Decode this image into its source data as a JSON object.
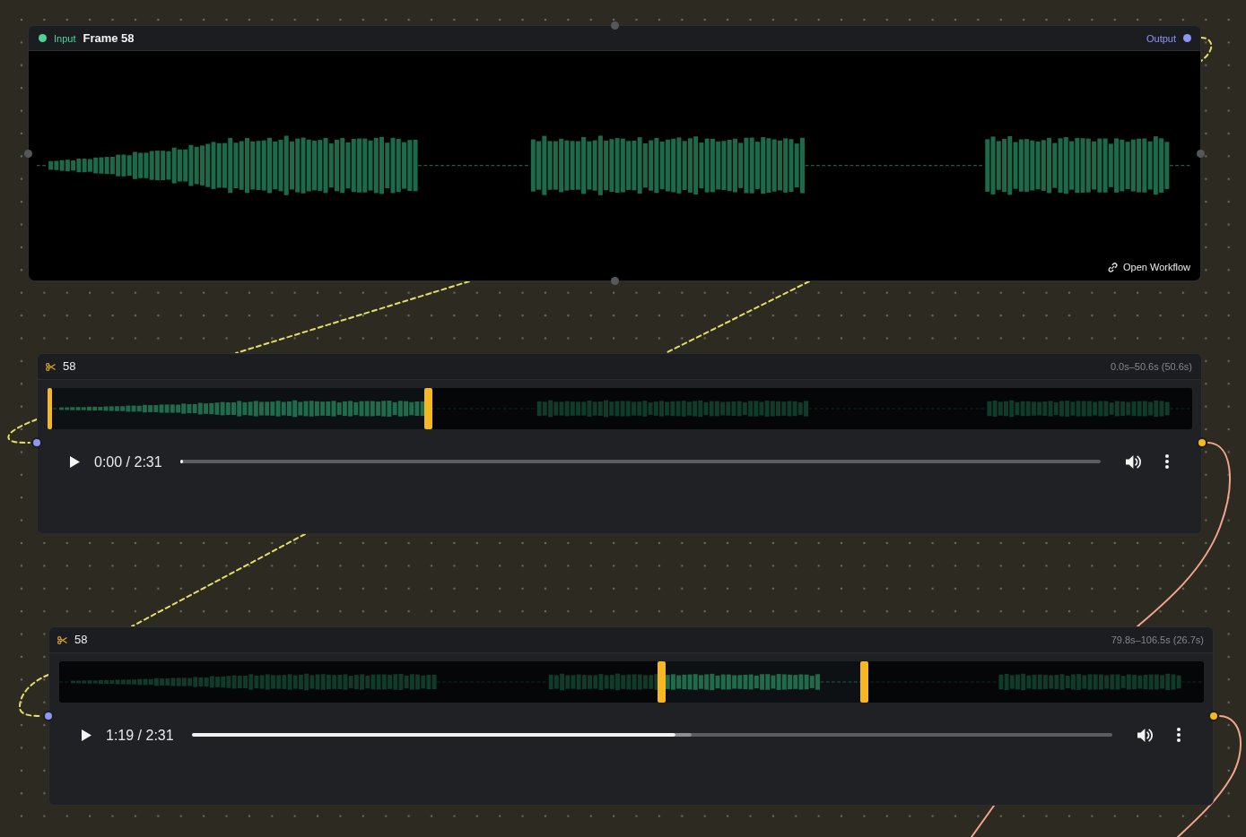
{
  "source_node": {
    "input_label": "Input",
    "title": "Frame 58",
    "output_label": "Output",
    "link": "Open Workflow"
  },
  "clip_nodes": [
    {
      "title": "58",
      "range": "0.0s–50.6s (50.6s)",
      "trim_start": {
        "level": 0
      },
      "trim_end": {
        "level": 0.333
      },
      "player": {
        "time": "0:00 / 2:31",
        "level": 0
      }
    },
    {
      "title": "58",
      "range": "79.8s–106.5s (26.7s)",
      "trim_start": {
        "level": 0.526
      },
      "trim_end": {
        "level": 0.703
      },
      "player": {
        "time": "1:19 / 2:31",
        "level": 0.526,
        "buffer": {
          "level": 0.543
        }
      }
    }
  ],
  "connections": [
    {
      "kind": "dashed"
    },
    {
      "kind": "dashed"
    },
    {
      "kind": "dashed"
    },
    {
      "kind": "dashed"
    },
    {
      "kind": "solid"
    },
    {
      "kind": "dashed"
    },
    {
      "kind": "dashed"
    },
    {
      "kind": "solid"
    },
    {
      "kind": "solid"
    }
  ]
}
